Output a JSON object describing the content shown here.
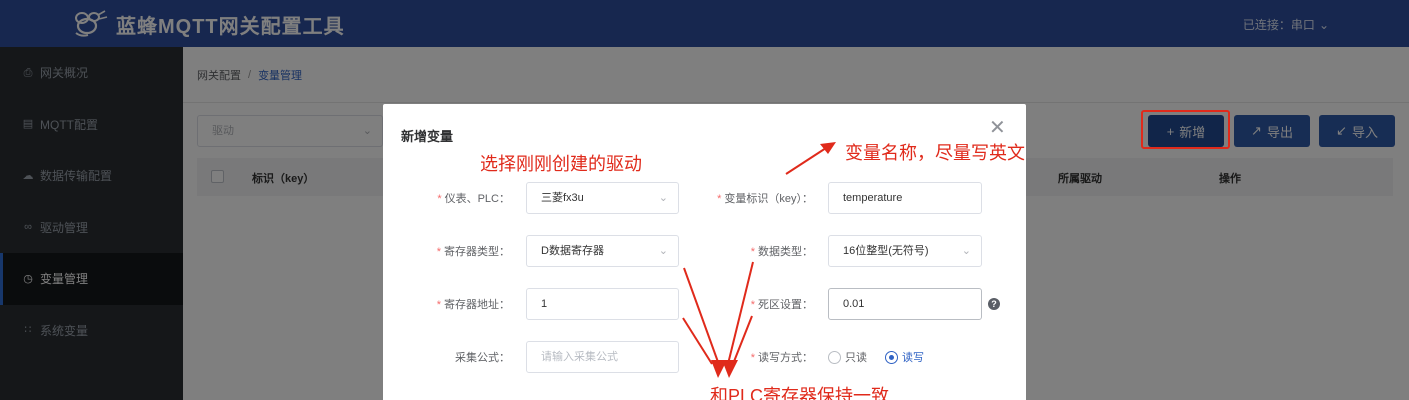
{
  "header": {
    "title": "蓝蜂MQTT网关配置工具",
    "connection": "已连接：串口"
  },
  "sidebar": {
    "items": [
      {
        "label": "网关概况",
        "icon": "printer-icon"
      },
      {
        "label": "MQTT配置",
        "icon": "list-icon"
      },
      {
        "label": "数据传输配置",
        "icon": "cloud-icon"
      },
      {
        "label": "驱动管理",
        "icon": "link-icon"
      },
      {
        "label": "变量管理",
        "icon": "clock-icon",
        "active": true
      },
      {
        "label": "系统变量",
        "icon": "grid-icon"
      }
    ]
  },
  "breadcrumb": {
    "root": "网关配置",
    "separator": "/",
    "current": "变量管理"
  },
  "toolbar": {
    "driver_placeholder": "驱动",
    "add_label": "新增",
    "export_label": "导出",
    "import_label": "导入"
  },
  "table": {
    "columns": [
      "标识（key）",
      "所属驱动",
      "操作"
    ]
  },
  "dialog": {
    "title": "新增变量",
    "fields": {
      "instrument": {
        "label": "仪表、PLC：",
        "value": "三菱fx3u"
      },
      "var_key": {
        "label": "变量标识（key）：",
        "value": "temperature"
      },
      "register_type": {
        "label": "寄存器类型：",
        "value": "D数据寄存器"
      },
      "data_type": {
        "label": "数据类型：",
        "value": "16位整型(无符号)"
      },
      "register_addr": {
        "label": "寄存器地址：",
        "value": "1"
      },
      "deadband": {
        "label": "死区设置：",
        "value": "0.01"
      },
      "formula": {
        "label": "采集公式：",
        "placeholder": "请输入采集公式"
      },
      "rw_mode": {
        "label": "读写方式：",
        "options": [
          "只读",
          "读写"
        ],
        "selected": "读写"
      }
    }
  },
  "annotations": {
    "driver_note": "选择刚刚创建的驱动",
    "name_note": "变量名称，尽量写英文",
    "plc_note": "和PLC寄存器保持一致"
  },
  "colors": {
    "header": "#2f4f9e",
    "sidebar": "#2b2f33",
    "primary_button": "#2f5aa8",
    "annotation": "#e02a1b",
    "link": "#2f62c4"
  }
}
